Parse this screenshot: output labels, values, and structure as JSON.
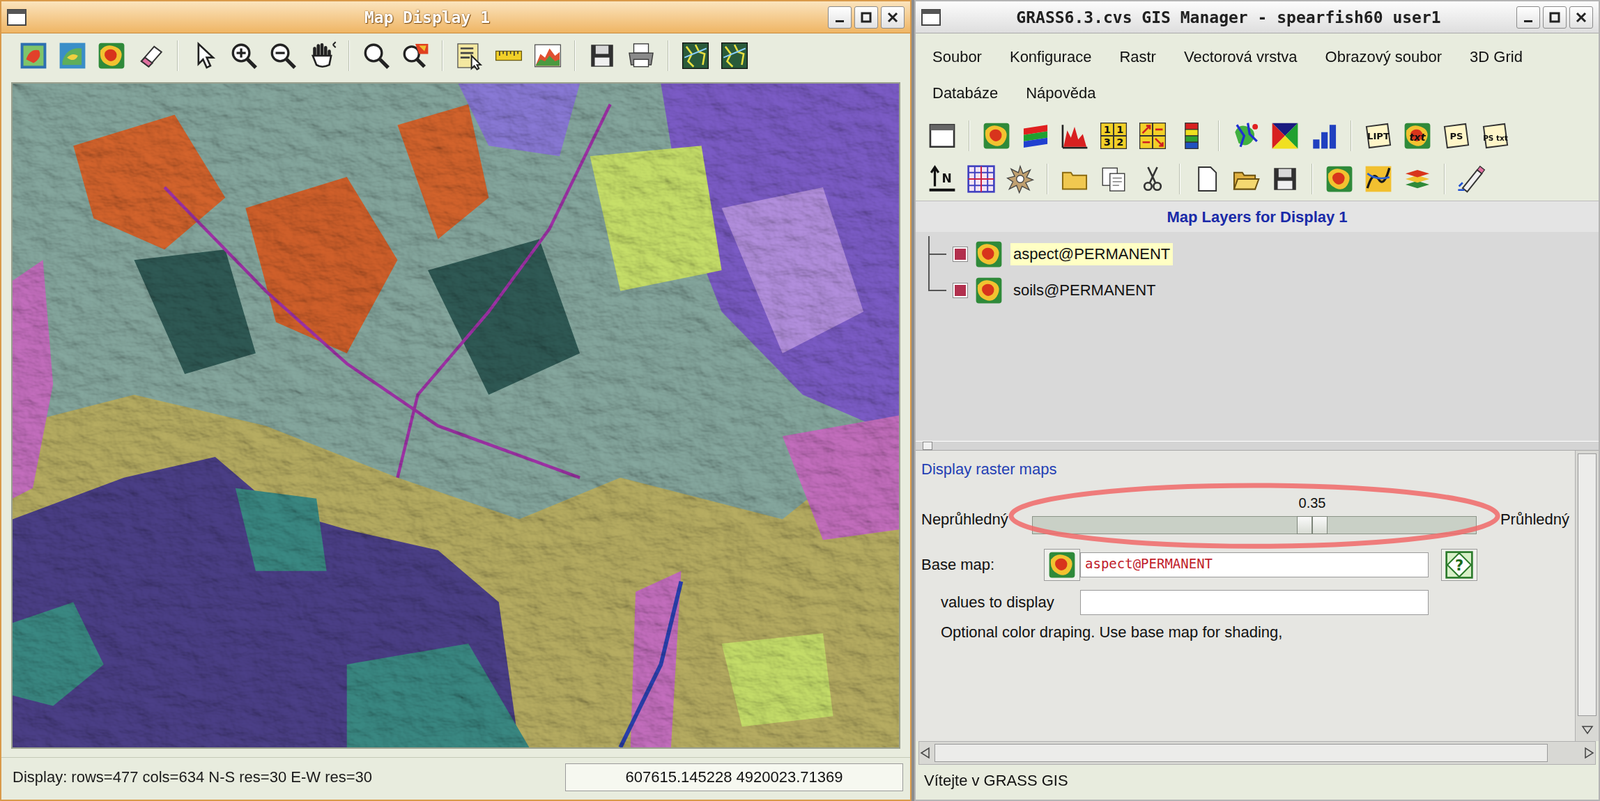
{
  "map_display": {
    "window": {
      "title": "Map Display 1",
      "active": true
    },
    "toolbar": [
      [
        {
          "kind": "display"
        },
        {
          "kind": "redisplay"
        },
        {
          "kind": "raster"
        },
        {
          "kind": "erase"
        }
      ],
      [
        {
          "kind": "pointer"
        },
        {
          "kind": "zoom-in"
        },
        {
          "kind": "zoom-out"
        },
        {
          "kind": "pan"
        }
      ],
      [
        {
          "kind": "zoom-back"
        },
        {
          "kind": "zoom-menu"
        }
      ],
      [
        {
          "kind": "query"
        },
        {
          "kind": "measure"
        },
        {
          "kind": "profile"
        }
      ],
      [
        {
          "kind": "save"
        },
        {
          "kind": "print"
        }
      ],
      [
        {
          "kind": "decor"
        },
        {
          "kind": "decor"
        }
      ]
    ],
    "status_bar": {
      "text": "Display: rows=477 cols=634 N-S res=30 E-W res=30",
      "coordinates": "607615.145228 4920023.71369"
    }
  },
  "gis_manager": {
    "window": {
      "title": "GRASS6.3.cvs GIS Manager - spearfish60 user1",
      "active": false
    },
    "menu": [
      [
        "Soubor",
        "Konfigurace",
        "Rastr",
        "Vectorová vrstva",
        "Obrazový soubor",
        "3D Grid"
      ],
      [
        "Databáze",
        "Nápověda"
      ]
    ],
    "toolbars": [
      [
        [
          {
            "kind": "window"
          }
        ],
        [
          {
            "kind": "raster"
          },
          {
            "kind": "raster-rgb"
          },
          {
            "kind": "histogram"
          },
          {
            "kind": "grid-num",
            "label": "1132"
          },
          {
            "kind": "arrows-num"
          },
          {
            "kind": "legend"
          }
        ],
        [
          {
            "kind": "vector"
          },
          {
            "kind": "triangle"
          },
          {
            "kind": "bar-chart"
          }
        ],
        [
          {
            "kind": "text-label",
            "label": "LIPT"
          },
          {
            "kind": "raster-text",
            "label": "txt"
          },
          {
            "kind": "text-label",
            "label": "PS"
          },
          {
            "kind": "text-label",
            "label": "PS txt"
          }
        ]
      ],
      [
        [
          {
            "kind": "north",
            "label": "N"
          },
          {
            "kind": "grid"
          },
          {
            "kind": "gear"
          }
        ],
        [
          {
            "kind": "folder"
          },
          {
            "kind": "copy"
          },
          {
            "kind": "cut"
          }
        ],
        [
          {
            "kind": "new"
          },
          {
            "kind": "open"
          },
          {
            "kind": "save"
          }
        ],
        [
          {
            "kind": "raster"
          },
          {
            "kind": "vector-line"
          },
          {
            "kind": "raster-stack"
          }
        ],
        [
          {
            "kind": "pencil"
          }
        ]
      ]
    ],
    "layer_tree": {
      "title": "Map Layers for Display 1",
      "layers": [
        {
          "name": "aspect@PERMANENT",
          "checked": true,
          "selected": true
        },
        {
          "name": "soils@PERMANENT",
          "checked": true,
          "selected": false
        }
      ]
    },
    "options": {
      "title": "Display raster maps",
      "opacity": {
        "left_label": "Neprůhledný",
        "right_label": "Průhledný",
        "reading": "0.35",
        "level": 0.64
      },
      "base_map": {
        "label": "Base map:",
        "value": "aspect@PERMANENT",
        "help": "?"
      },
      "values": {
        "label": "values to display",
        "value": ""
      },
      "note": "Optional color draping. Use base map for shading,"
    },
    "status_bar": "Vítejte v GRASS GIS"
  }
}
